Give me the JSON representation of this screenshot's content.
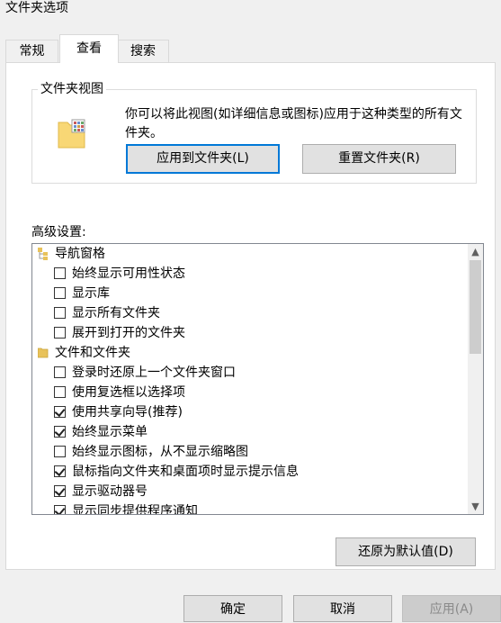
{
  "window": {
    "title": "文件夹选项"
  },
  "tabs": [
    {
      "label": "常规",
      "active": false
    },
    {
      "label": "查看",
      "active": true
    },
    {
      "label": "搜索",
      "active": false
    }
  ],
  "folder_views": {
    "title": "文件夹视图",
    "description": "你可以将此视图(如详细信息或图标)应用于这种类型的所有文件夹。",
    "apply_button": "应用到文件夹(L)",
    "reset_button": "重置文件夹(R)"
  },
  "advanced": {
    "label": "高级设置:",
    "items": [
      {
        "type": "group",
        "label": "导航窗格",
        "icon": "nav-pane-icon"
      },
      {
        "type": "checkbox",
        "label": "始终显示可用性状态",
        "checked": false
      },
      {
        "type": "checkbox",
        "label": "显示库",
        "checked": false
      },
      {
        "type": "checkbox",
        "label": "显示所有文件夹",
        "checked": false
      },
      {
        "type": "checkbox",
        "label": "展开到打开的文件夹",
        "checked": false
      },
      {
        "type": "group",
        "label": "文件和文件夹",
        "icon": "folder-icon"
      },
      {
        "type": "checkbox",
        "label": "登录时还原上一个文件夹窗口",
        "checked": false
      },
      {
        "type": "checkbox",
        "label": "使用复选框以选择项",
        "checked": false
      },
      {
        "type": "checkbox",
        "label": "使用共享向导(推荐)",
        "checked": true
      },
      {
        "type": "checkbox",
        "label": "始终显示菜单",
        "checked": true
      },
      {
        "type": "checkbox",
        "label": "始终显示图标，从不显示缩略图",
        "checked": false
      },
      {
        "type": "checkbox",
        "label": "鼠标指向文件夹和桌面项时显示提示信息",
        "checked": true
      },
      {
        "type": "checkbox",
        "label": "显示驱动器号",
        "checked": true
      },
      {
        "type": "checkbox",
        "label": "显示同步提供程序通知",
        "checked": true
      }
    ]
  },
  "restore_defaults_button": "还原为默认值(D)",
  "footer": {
    "ok": "确定",
    "cancel": "取消",
    "apply": "应用(A)"
  },
  "colors": {
    "accent": "#0078d7",
    "folder": "#f8d775"
  }
}
